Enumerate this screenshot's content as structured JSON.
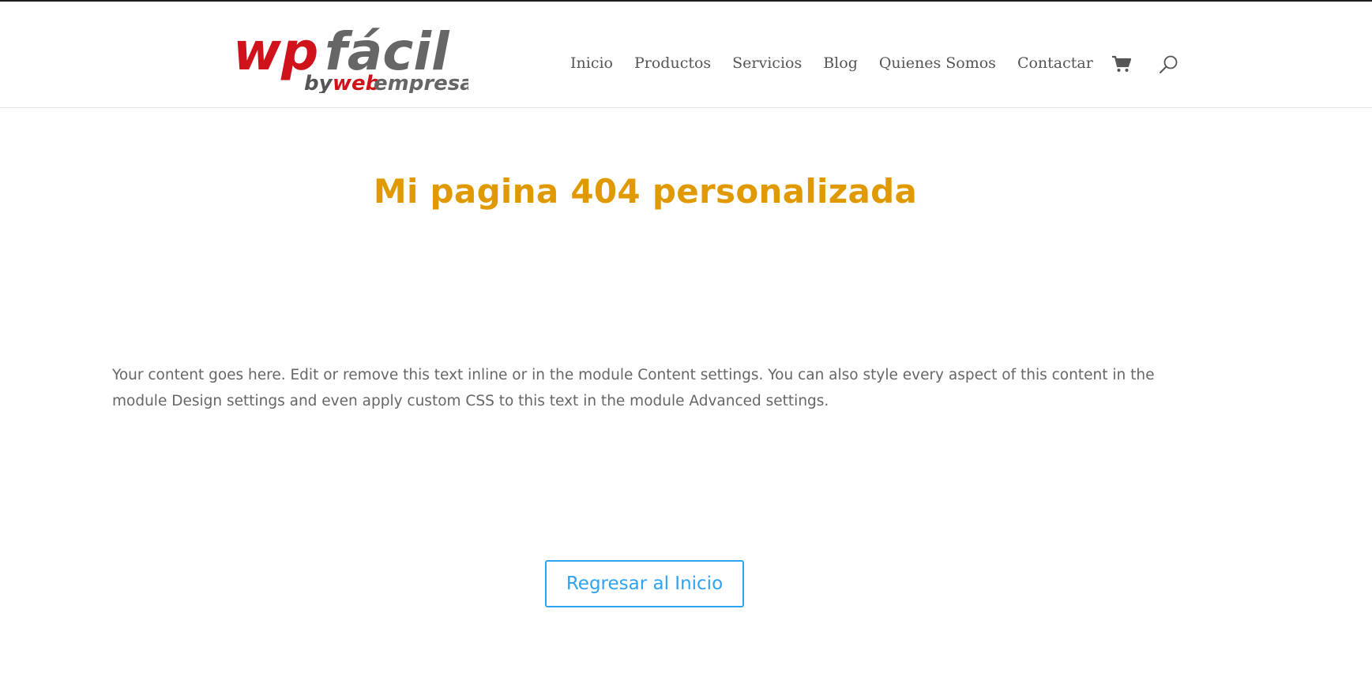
{
  "logo": {
    "wp": "wp",
    "facil": "fácil",
    "by": "by",
    "web": "web",
    "empresa": "empresa",
    "colors": {
      "red": "#d0121b",
      "gray": "#666666"
    }
  },
  "nav": {
    "items": [
      {
        "label": "Inicio"
      },
      {
        "label": "Productos"
      },
      {
        "label": "Servicios"
      },
      {
        "label": "Blog"
      },
      {
        "label": "Quienes Somos"
      },
      {
        "label": "Contactar"
      }
    ],
    "cart_icon": "shopping-cart-icon",
    "search_icon": "search-icon"
  },
  "main": {
    "title": "Mi pagina 404 personalizada",
    "body": "Your content goes here. Edit or remove this text inline or in the module Content settings. You can also style every aspect of this content in the module Design settings and even apply custom CSS to this text in the module Advanced settings.",
    "button_label": "Regresar al Inicio"
  },
  "colors": {
    "title": "#e09900",
    "button": "#2ea3f2",
    "text": "#666666",
    "nav": "#555555"
  }
}
